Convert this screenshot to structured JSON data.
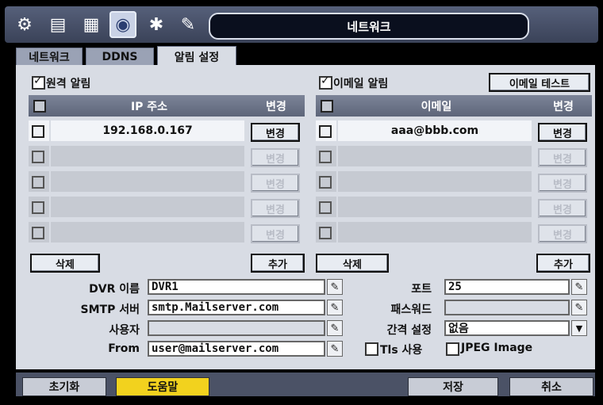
{
  "window": {
    "title": "네트워크"
  },
  "toolbar": {
    "icons": [
      "gear-icon",
      "storage-icon",
      "record-icon",
      "network-icon",
      "event-icon",
      "tool-icon"
    ]
  },
  "tabs": [
    {
      "label": "네트워크"
    },
    {
      "label": "DDNS"
    },
    {
      "label": "알림 설정"
    }
  ],
  "remote_alert": {
    "checkbox_label": "원격 알림",
    "checked": true,
    "headers": {
      "ip": "IP 주소",
      "change": "변경"
    },
    "rows": [
      {
        "value": "192.168.0.167",
        "change": "변경",
        "enabled": true
      },
      {
        "value": "",
        "change": "변경",
        "enabled": false
      },
      {
        "value": "",
        "change": "변경",
        "enabled": false
      },
      {
        "value": "",
        "change": "변경",
        "enabled": false
      },
      {
        "value": "",
        "change": "변경",
        "enabled": false
      }
    ],
    "delete_label": "삭제",
    "add_label": "추가"
  },
  "email_alert": {
    "checkbox_label": "이메일 알림",
    "checked": true,
    "test_label": "이메일 테스트",
    "headers": {
      "email": "이메일",
      "change": "변경"
    },
    "rows": [
      {
        "value": "aaa@bbb.com",
        "change": "변경",
        "enabled": true
      },
      {
        "value": "",
        "change": "변경",
        "enabled": false
      },
      {
        "value": "",
        "change": "변경",
        "enabled": false
      },
      {
        "value": "",
        "change": "변경",
        "enabled": false
      },
      {
        "value": "",
        "change": "변경",
        "enabled": false
      }
    ],
    "delete_label": "삭제",
    "add_label": "추가"
  },
  "form": {
    "dvr_name_label": "DVR 이름",
    "dvr_name": "DVR1",
    "smtp_label": "SMTP 서버",
    "smtp": "smtp.Mailserver.com",
    "user_label": "사용자",
    "user": "",
    "from_label": "From",
    "from": "user@mailserver.com",
    "port_label": "포트",
    "port": "25",
    "password_label": "패스워드",
    "password": "",
    "interval_label": "간격 설정",
    "interval": "없음",
    "tls_label": "Tls 사용",
    "jpeg_label": "JPEG Image"
  },
  "footer": {
    "reset": "초기화",
    "help": "도움말",
    "save": "저장",
    "cancel": "취소"
  },
  "colors": {
    "help_button": "#f2d21e",
    "header": "#5d6579",
    "panel": "#d8dce4"
  }
}
